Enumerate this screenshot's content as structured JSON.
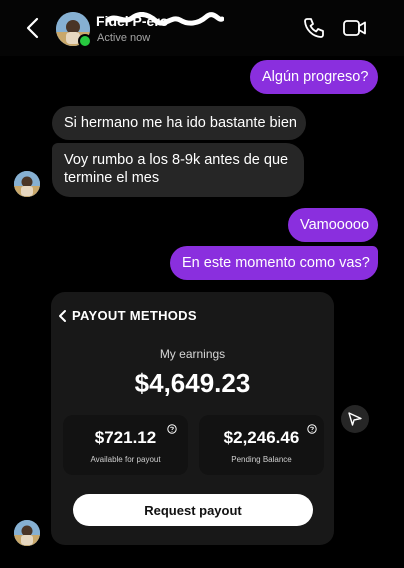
{
  "header": {
    "contact_name": "Fidel Р-ero",
    "status": "Active now",
    "icons": {
      "back": "chevron-left-icon",
      "call": "phone-icon",
      "video": "video-camera-icon"
    }
  },
  "messages": [
    {
      "direction": "sent",
      "text": "Algún progreso?"
    },
    {
      "direction": "received",
      "text": "Si hermano me ha ido bastante bien"
    },
    {
      "direction": "received",
      "text": "Voy rumbo a los 8-9k antes de que termine el mes"
    },
    {
      "direction": "sent",
      "text": "Vamooooo"
    },
    {
      "direction": "sent",
      "text": "En este momento como vas?"
    }
  ],
  "shared_screenshot": {
    "title": "PAYOUT METHODS",
    "earnings_label": "My earnings",
    "earnings_total": "$4,649.23",
    "available": {
      "amount": "$721.12",
      "label": "Available for payout"
    },
    "pending": {
      "amount": "$2,246.46",
      "label": "Pending Balance"
    },
    "request_button": "Request payout"
  },
  "colors": {
    "sent_bubble": "#8a2fde",
    "received_bubble": "#262626",
    "background": "#000000",
    "online": "#27c93f"
  }
}
